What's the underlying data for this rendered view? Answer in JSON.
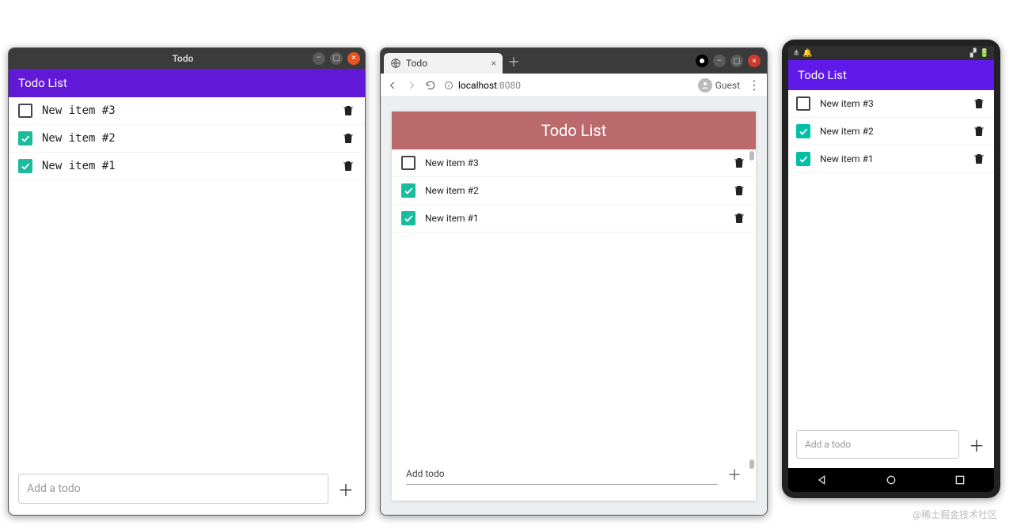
{
  "apps": {
    "desktop": {
      "window_title": "Todo",
      "appbar_title": "Todo List",
      "accent_color": "#6218d7",
      "check_color": "#1abc9c",
      "items": [
        {
          "label": "New item #3",
          "checked": false
        },
        {
          "label": "New item #2",
          "checked": true
        },
        {
          "label": "New item #1",
          "checked": true
        }
      ],
      "add_placeholder": "Add a todo"
    },
    "browser": {
      "tab_title": "Todo",
      "url_host": "localhost",
      "url_port": ":8080",
      "guest_label": "Guest",
      "appbar_title": "Todo List",
      "accent_color": "#bb6a6c",
      "check_color": "#4caf50",
      "items": [
        {
          "label": "New item #3",
          "checked": false
        },
        {
          "label": "New item #2",
          "checked": true
        },
        {
          "label": "New item #1",
          "checked": true
        }
      ],
      "add_placeholder": "Add todo"
    },
    "mobile": {
      "appbar_title": "Todo List",
      "accent_color": "#5f19e8",
      "check_color": "#00bfa5",
      "items": [
        {
          "label": "New item #3",
          "checked": false
        },
        {
          "label": "New item #2",
          "checked": true
        },
        {
          "label": "New item #1",
          "checked": true
        }
      ],
      "add_placeholder": "Add a todo"
    }
  },
  "watermark": "@稀土掘金技术社区"
}
